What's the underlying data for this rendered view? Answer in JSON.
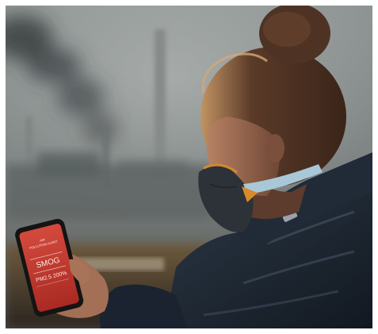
{
  "scene": {
    "description_tags": [
      "smog",
      "industrial-chimneys",
      "woman",
      "face-mask",
      "smartphone"
    ],
    "colors": {
      "sky_top": "#8e9392",
      "sky_bottom": "#5e6463",
      "haze": "#a7acaa",
      "chimney": "#7a7f7e",
      "smoke": "#3c3f40",
      "ground": "#3a3128",
      "ground_glow": "#6e5838",
      "jacket": "#1b2430",
      "jacket_highlight": "#33414f",
      "hair": "#4a3124",
      "hair_rim": "#b88d5d",
      "skin": "#a77458",
      "skin_shadow": "#6f4836",
      "mask": "#2e3439",
      "mask_strap": "#a6c7d8",
      "mask_trim": "#d98a2a",
      "phone_body": "#161616",
      "phone_screen": "#c9372c",
      "phone_screen_light": "#e0584a"
    }
  },
  "phone": {
    "header": "AIR POLLUTION ALERT",
    "header_line1": "AIR",
    "header_line2": "POLLUTION ALERT",
    "main_label": "SMOG",
    "reading": "PM2.5 200%"
  }
}
